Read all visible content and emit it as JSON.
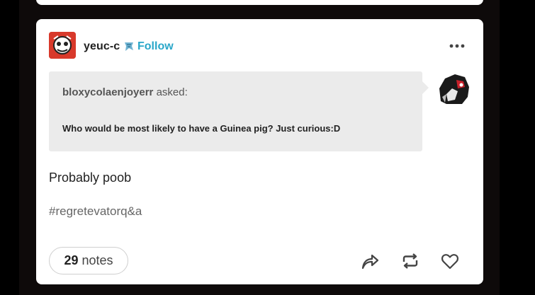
{
  "post": {
    "blog_name": "yeuc-c",
    "follow_label": "Follow",
    "more_label": "•••",
    "ask": {
      "asker": "bloxycolaenjoyerr",
      "asked_suffix": "asked:",
      "question": "Who would be most likely to have a Guinea pig? Just curious:D"
    },
    "answer": "Probably poob",
    "tags": [
      "#regretevatorq&a"
    ],
    "notes": {
      "count": "29",
      "label": "notes"
    }
  },
  "icons": {
    "avatar": "blog-avatar",
    "follow": "follow-badge-icon",
    "more": "ellipsis-icon",
    "share": "share-icon",
    "reblog": "reblog-icon",
    "like": "heart-icon"
  },
  "colors": {
    "background": "#0e0a0a",
    "card": "#ffffff",
    "follow": "#2aa7c9",
    "ask_box": "#ebebeb"
  }
}
